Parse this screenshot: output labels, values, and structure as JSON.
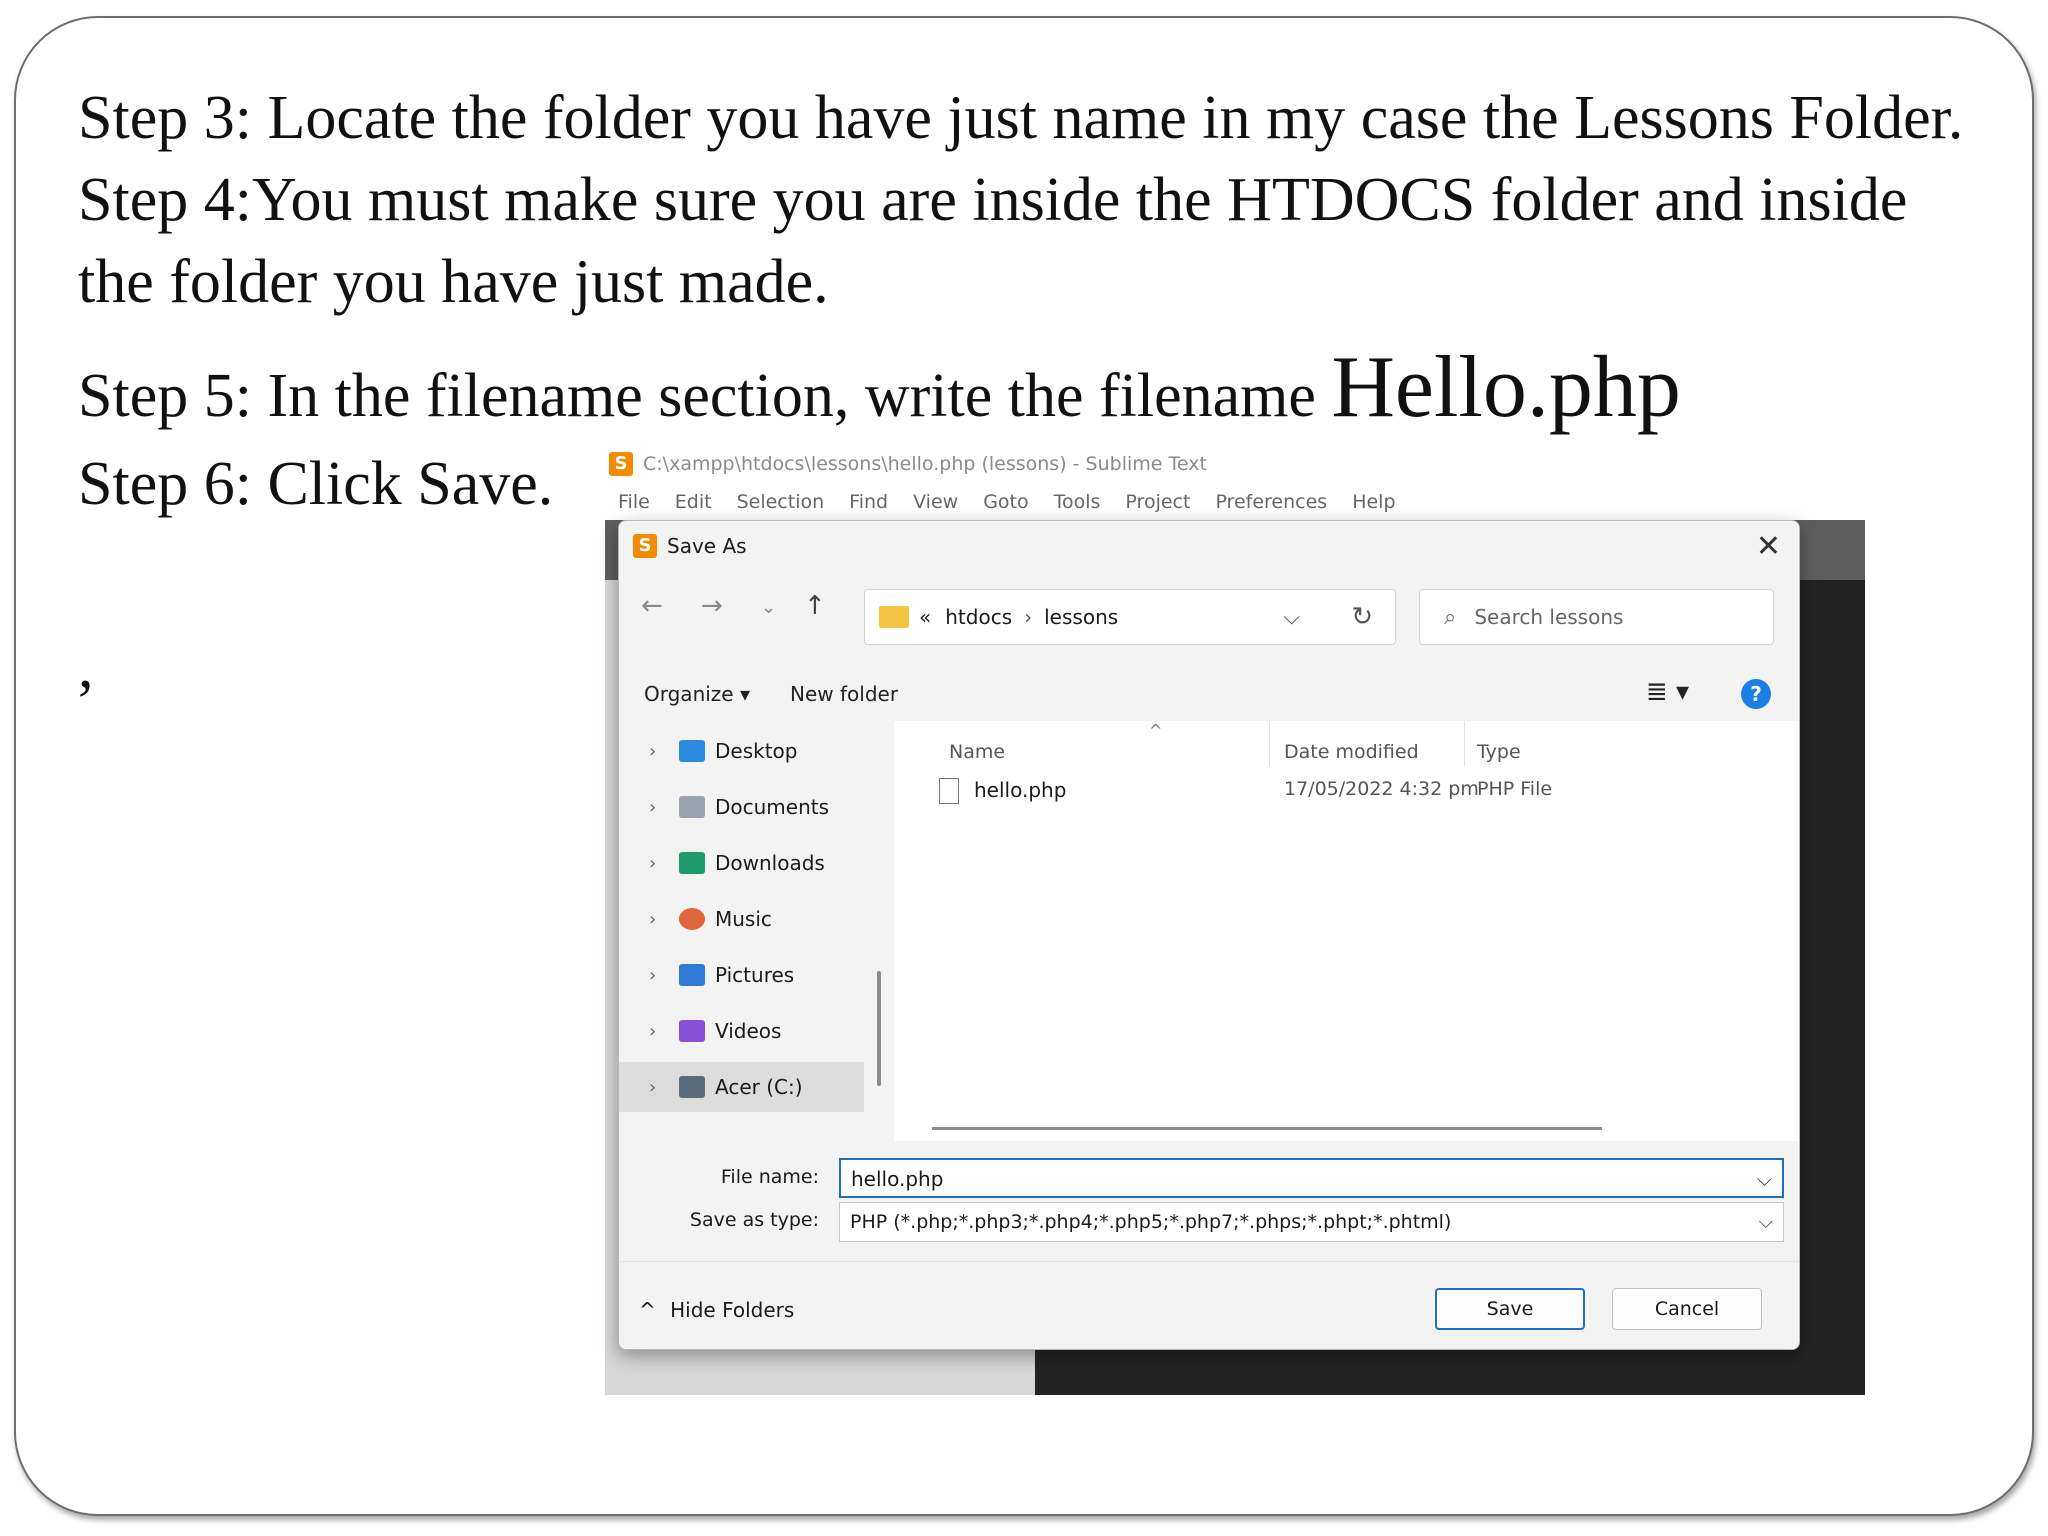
{
  "slide": {
    "step3": "Step 3: Locate the folder you have just name in my case the Lessons Folder.",
    "step4_line1": "Step 4:You must make sure you are inside the HTDOCS folder and inside",
    "step4_line2": "the folder you have just made.",
    "step5_prefix": "Step 5: In the filename section, write the filename ",
    "step5_filename": "Hello.php",
    "step6": "Step 6: Click Save.",
    "stray_mark": ","
  },
  "sublime": {
    "title": "C:\\xampp\\htdocs\\lessons\\hello.php (lessons) - Sublime Text",
    "logo_glyph": "S",
    "menu": [
      "File",
      "Edit",
      "Selection",
      "Find",
      "View",
      "Goto",
      "Tools",
      "Project",
      "Preferences",
      "Help"
    ]
  },
  "dialog": {
    "title": "Save As",
    "close_glyph": "✕",
    "nav": {
      "back": "←",
      "forward": "→",
      "recent": "⌄",
      "up": "↑"
    },
    "address": {
      "prefix": "«",
      "crumbs": [
        "htdocs",
        "lessons"
      ],
      "separator": "›",
      "dropdown": "⌵",
      "refresh": "↻"
    },
    "search_placeholder": "Search lessons",
    "commands": {
      "organize": "Organize ▾",
      "new_folder": "New folder",
      "view_glyph": "≣ ▾",
      "help_glyph": "?"
    },
    "nav_pane": [
      {
        "label": "Desktop",
        "icon": "desktop-icon",
        "color": "#2b8be0"
      },
      {
        "label": "Documents",
        "icon": "documents-icon",
        "color": "#9aa3ad"
      },
      {
        "label": "Downloads",
        "icon": "downloads-icon",
        "color": "#1d9b6c"
      },
      {
        "label": "Music",
        "icon": "music-icon",
        "color": "#e0673c"
      },
      {
        "label": "Pictures",
        "icon": "pictures-icon",
        "color": "#2f7bd6"
      },
      {
        "label": "Videos",
        "icon": "videos-icon",
        "color": "#8a4fd8"
      },
      {
        "label": "Acer (C:)",
        "icon": "drive-icon",
        "color": "#5a6b7c"
      }
    ],
    "columns": {
      "name": "Name",
      "date": "Date modified",
      "type": "Type"
    },
    "files": [
      {
        "name": "hello.php",
        "date": "17/05/2022 4:32 pm",
        "type": "PHP File"
      }
    ],
    "file_name_label": "File name:",
    "file_name_value": "hello.php",
    "save_type_label": "Save as type:",
    "save_type_value": "PHP (*.php;*.php3;*.php4;*.php5;*.php7;*.phps;*.phpt;*.phtml)",
    "hide_folders": "Hide Folders",
    "save_button": "Save",
    "cancel_button": "Cancel"
  }
}
